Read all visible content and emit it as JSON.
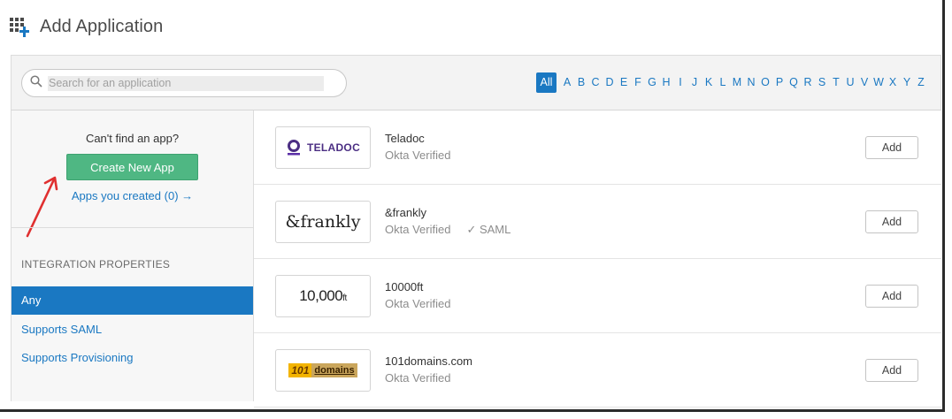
{
  "header": {
    "title": "Add Application",
    "icon": "grid-add-icon"
  },
  "search": {
    "placeholder": "Search for an application"
  },
  "alphabet": [
    "All",
    "A",
    "B",
    "C",
    "D",
    "E",
    "F",
    "G",
    "H",
    "I",
    "J",
    "K",
    "L",
    "M",
    "N",
    "O",
    "P",
    "Q",
    "R",
    "S",
    "T",
    "U",
    "V",
    "W",
    "X",
    "Y",
    "Z"
  ],
  "sidebar": {
    "cant_find": "Can't find an app?",
    "create_button": "Create New App",
    "apps_created": "Apps you created (0) →",
    "integration_title": "INTEGRATION PROPERTIES",
    "filters": [
      {
        "label": "Any",
        "active": true
      },
      {
        "label": "Supports SAML",
        "active": false
      },
      {
        "label": "Supports Provisioning",
        "active": false
      }
    ]
  },
  "apps": [
    {
      "name": "Teladoc",
      "meta": "Okta Verified",
      "saml": "",
      "logo_text": "TELADOC",
      "add_label": "Add"
    },
    {
      "name": "&frankly",
      "meta": "Okta Verified",
      "saml": "✓ SAML",
      "logo_text": "&frankly",
      "add_label": "Add"
    },
    {
      "name": "10000ft",
      "meta": "Okta Verified",
      "saml": "",
      "logo_text": "10,000",
      "logo_suffix": "ft",
      "add_label": "Add"
    },
    {
      "name": "101domains.com",
      "meta": "Okta Verified",
      "saml": "",
      "logo_mark": "101",
      "logo_text": "domains",
      "add_label": "Add"
    }
  ],
  "colors": {
    "accent": "#1a78c2",
    "create_button": "#4fb783",
    "arrow": "#e03030",
    "teladoc": "#4b2e83"
  }
}
